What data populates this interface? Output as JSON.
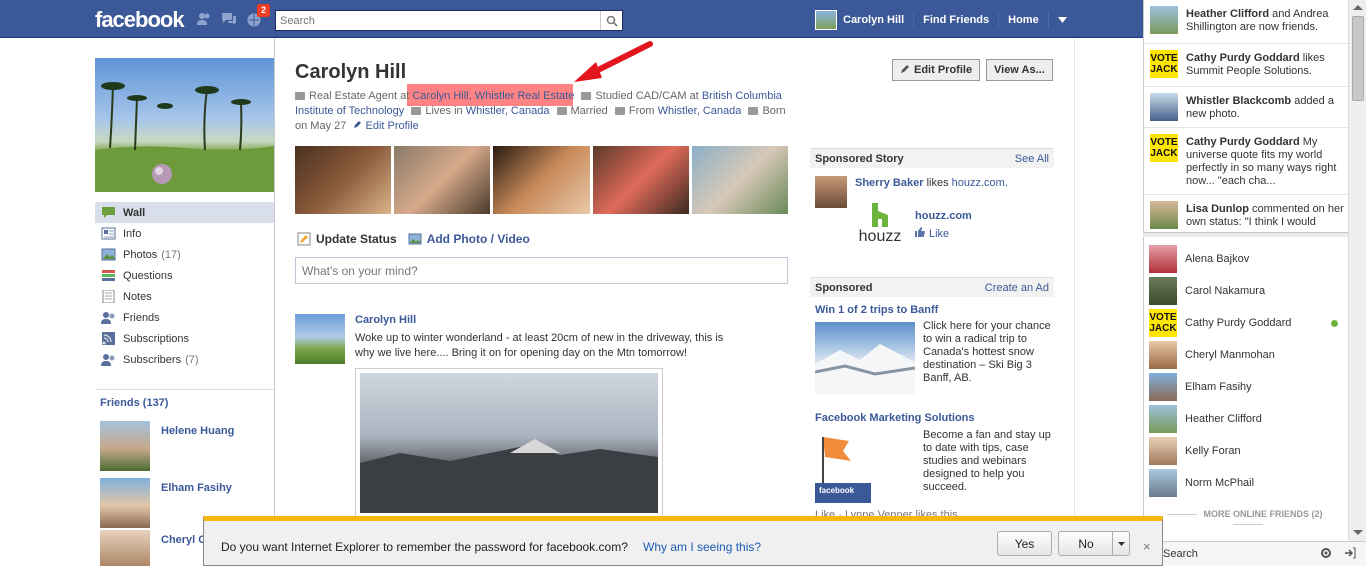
{
  "topbar": {
    "logo": "facebook",
    "notifications_count": "2",
    "search_placeholder": "Search",
    "user_name": "Carolyn Hill",
    "find_friends": "Find Friends",
    "home": "Home"
  },
  "left_nav": {
    "items": [
      {
        "label": "Wall",
        "count": ""
      },
      {
        "label": "Info",
        "count": ""
      },
      {
        "label": "Photos",
        "count": "(17)"
      },
      {
        "label": "Questions",
        "count": ""
      },
      {
        "label": "Notes",
        "count": ""
      },
      {
        "label": "Friends",
        "count": ""
      },
      {
        "label": "Subscriptions",
        "count": ""
      },
      {
        "label": "Subscribers",
        "count": "(7)"
      }
    ],
    "friends_heading": "Friends (137)",
    "friends": [
      "Helene Huang",
      "Elham Fasihy",
      "Cheryl C"
    ]
  },
  "profile": {
    "name": "Carolyn Hill",
    "edit_profile_btn": "Edit Profile",
    "view_as_btn": "View As...",
    "info": {
      "job_prefix": "Real Estate Agent at",
      "job_link": "Carolyn Hill, Whistler Real Estate",
      "studied_prefix": "Studied CAD/CAM at",
      "school_link": "British Columbia Institute of Technology",
      "lives_prefix": "Lives in",
      "lives_link": "Whistler, Canada",
      "married": "Married",
      "from_prefix": "From",
      "from_link": "Whistler, Canada",
      "born": "Born on May 27",
      "edit_link": "Edit Profile"
    }
  },
  "composer": {
    "update_status": "Update Status",
    "add_photo": "Add Photo / Video",
    "placeholder": "What's on your mind?"
  },
  "story": {
    "author": "Carolyn Hill",
    "text": "Woke up to winter wonderland - at least 20cm of new in the driveway, this is why we live here.... Bring it on for opening day on the Mtn tomorrow!"
  },
  "sponsored_story": {
    "heading": "Sponsored Story",
    "see_all": "See All",
    "person": "Sherry Baker",
    "likes_word": "likes",
    "page_link": "houzz.com.",
    "logo_word": "houzz",
    "title": "houzz.com",
    "like": "Like"
  },
  "sponsored": {
    "heading": "Sponsored",
    "create_ad": "Create an Ad",
    "ads": [
      {
        "title": "Win 1 of 2 trips to Banff",
        "body": "Click here for your chance to win a radical trip to Canada's hottest snow destination – Ski Big 3 Banff, AB."
      },
      {
        "title": "Facebook Marketing Solutions",
        "body": "Become a fan and stay up to date with tips, case studies and webinars designed to help you succeed."
      }
    ],
    "ad2_img_caption": "facebook",
    "footer": "Like · Lynne Venner likes this."
  },
  "ticker": [
    {
      "bold": "Heather Clifford",
      "text": " and Andrea Shillington are now friends."
    },
    {
      "bold": "Cathy Purdy Goddard",
      "text": " likes Summit People Solutions."
    },
    {
      "bold": "Whistler Blackcomb",
      "text": " added a new photo."
    },
    {
      "bold": "Cathy Purdy Goddard",
      "text": " My universe quote fits my world perfectly in so many ways right now... \"each cha..."
    },
    {
      "bold": "Lisa Dunlop",
      "text": " commented on her own status: \"I think I would"
    }
  ],
  "vote_badge": "VOTE JACK",
  "chat": {
    "friends": [
      "Alena Bajkov",
      "Carol Nakamura",
      "Cathy Purdy Goddard",
      "Cheryl Manmohan",
      "Elham Fasihy",
      "Heather Clifford",
      "Kelly Foran",
      "Norm McPhail"
    ],
    "more_online": "MORE ONLINE FRIENDS (2)",
    "search_label": "Search"
  },
  "ie_dialog": {
    "message": "Do you want Internet Explorer to remember the password for facebook.com?",
    "why_link": "Why am I seeing this?",
    "yes": "Yes",
    "no": "No",
    "close": "×"
  }
}
